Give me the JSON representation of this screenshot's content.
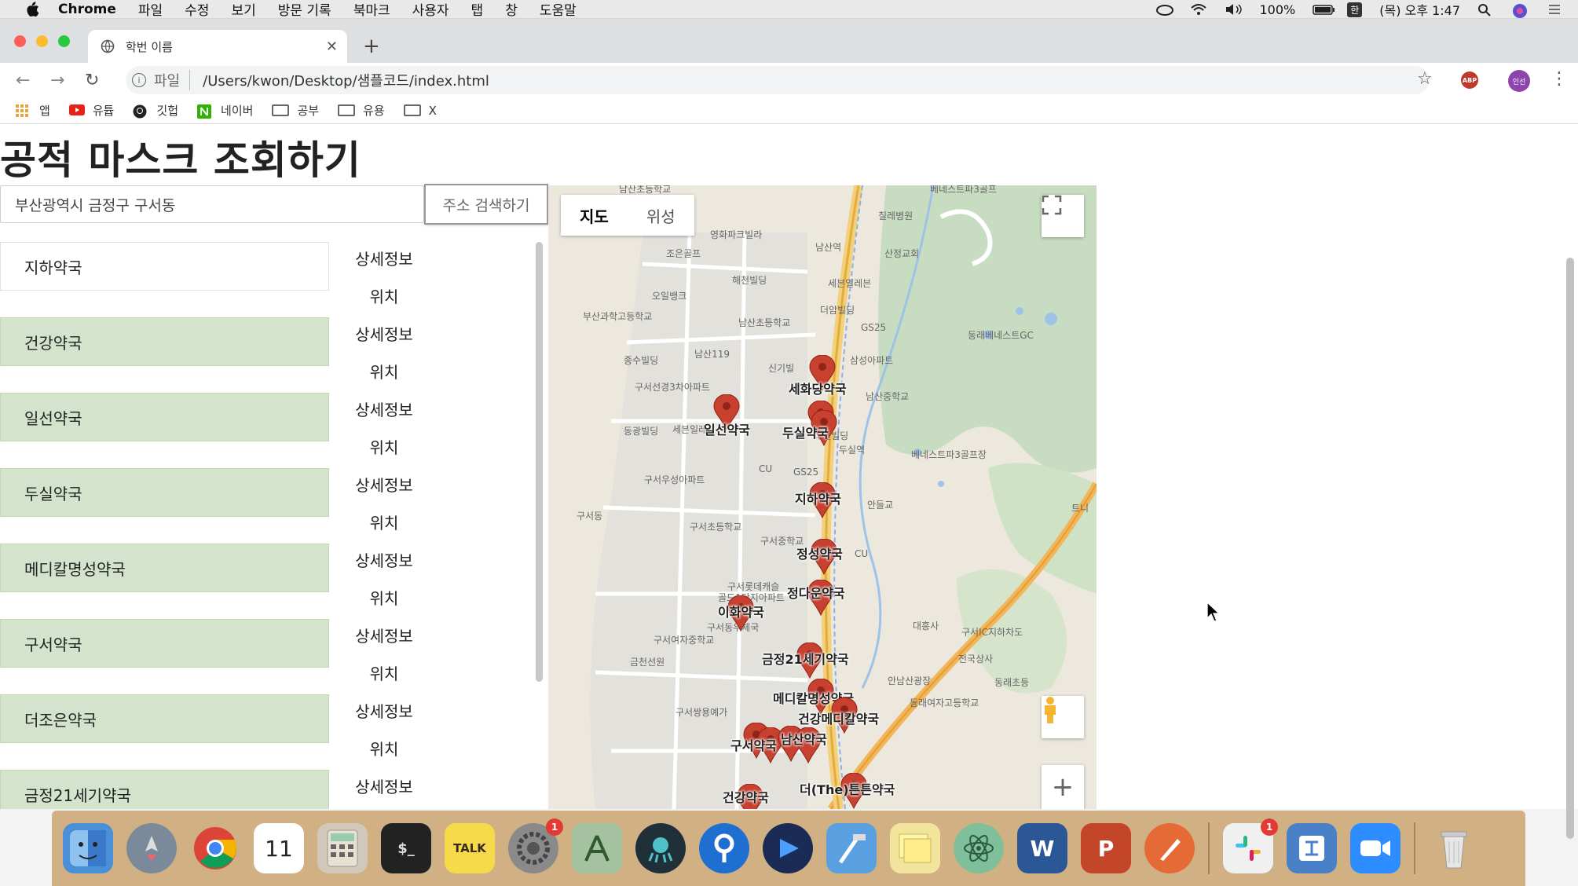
{
  "menubar": {
    "app_name": "Chrome",
    "items": [
      "파일",
      "수정",
      "보기",
      "방문 기록",
      "북마크",
      "사용자",
      "탭",
      "창",
      "도움말"
    ],
    "battery": "100%",
    "ime": "한",
    "clock": "(목) 오후 1:47"
  },
  "browser": {
    "tab_title": "학번 이름",
    "url_scheme": "파일",
    "url": "/Users/kwon/Desktop/샘플코드/index.html",
    "profile_label": "인선",
    "abp_label": "ABP"
  },
  "bookmarks": [
    {
      "label": "앱",
      "icon": "apps-grid-icon"
    },
    {
      "label": "유튭",
      "icon": "youtube-icon"
    },
    {
      "label": "깃헙",
      "icon": "github-icon"
    },
    {
      "label": "네이버",
      "icon": "naver-icon"
    },
    {
      "label": "공부",
      "icon": "folder-icon"
    },
    {
      "label": "유용",
      "icon": "folder-icon"
    },
    {
      "label": "X",
      "icon": "folder-icon"
    }
  ],
  "page": {
    "title": "공적 마스크 조회하기",
    "search_value": "부산광역시 금정구 구서동",
    "search_button": "주소 검색하기",
    "detail_label": "상세정보",
    "location_label": "위치",
    "pharmacies": [
      {
        "name": "지하약국",
        "highlight": false
      },
      {
        "name": "건강약국",
        "highlight": true
      },
      {
        "name": "일선약국",
        "highlight": true
      },
      {
        "name": "두실약국",
        "highlight": true
      },
      {
        "name": "메디칼명성약국",
        "highlight": true
      },
      {
        "name": "구서약국",
        "highlight": true
      },
      {
        "name": "더조은약국",
        "highlight": true
      },
      {
        "name": "금정21세기약국",
        "highlight": true
      }
    ]
  },
  "map": {
    "type_map": "지도",
    "type_satellite": "위성",
    "places": [
      "남산초등학교",
      "영화파크빌라",
      "남산역",
      "산정교회",
      "조은골프",
      "해천빌딩",
      "세븐일레븐",
      "오일뱅크",
      "더암빌딩",
      "부산과학고등학교",
      "남산초등학교",
      "GS25",
      "동래베네스트GC",
      "종수빌딩",
      "남산119",
      "신기빌",
      "삼성아파트",
      "구서선경3차아파트",
      "남산중학교",
      "동광빌딩",
      "세븐일레븐",
      "대원빌딩",
      "두실역",
      "베네스트파3골프장",
      "CU",
      "GS25",
      "구서우성아파트",
      "구서동",
      "안들교",
      "구서초등학교",
      "구서중학교",
      "CU",
      "구서롯데캐슬",
      "골드1단지아파트",
      "구서동우체국",
      "구서여자중학교",
      "금천선원",
      "대흥사",
      "구서IC지하차도",
      "전국상사",
      "안남산광장",
      "동래초등",
      "동래여자고등학교",
      "구서쌍용예가",
      "베네스트파3골프",
      "칠레병원",
      "트니"
    ],
    "markers": [
      {
        "label": "세화당약국"
      },
      {
        "label": "일선약국"
      },
      {
        "label": "두실약국"
      },
      {
        "label": "지하약국"
      },
      {
        "label": "정성약국"
      },
      {
        "label": "정다운약국"
      },
      {
        "label": "이화약국"
      },
      {
        "label": "금정21세기약국"
      },
      {
        "label": "메디칼명성약국"
      },
      {
        "label": "건강메디칼약국"
      },
      {
        "label": "구서약국"
      },
      {
        "label": "남산약국"
      },
      {
        "label": "더(The)튼튼약국"
      },
      {
        "label": "건강약국"
      }
    ],
    "colors": {
      "marker": "#c8402f",
      "road_major": "#f2b65a",
      "park": "#c7dcc0",
      "water": "#9ec3e8"
    }
  },
  "dock": {
    "apps": [
      {
        "name": "finder-icon",
        "color": "#4a90d9",
        "label": ""
      },
      {
        "name": "launchpad-icon",
        "color": "#7a8a9a",
        "label": ""
      },
      {
        "name": "chrome-icon",
        "color": "#e0e0e0",
        "label": ""
      },
      {
        "name": "calendar-icon",
        "color": "#ffffff",
        "label": "11"
      },
      {
        "name": "calculator-icon",
        "color": "#d0c8b8",
        "label": ""
      },
      {
        "name": "terminal-icon",
        "color": "#222222",
        "label": "$_"
      },
      {
        "name": "kakaotalk-icon",
        "color": "#f7d94c",
        "label": "TALK"
      },
      {
        "name": "system-preferences-icon",
        "color": "#8a8a8a",
        "label": "",
        "badge": "1"
      },
      {
        "name": "android-studio-icon",
        "color": "#a4c2a0",
        "label": ""
      },
      {
        "name": "gitkraken-icon",
        "color": "#203038",
        "label": ""
      },
      {
        "name": "sourcetree-icon",
        "color": "#1f6fd0",
        "label": ""
      },
      {
        "name": "app-blue-icon",
        "color": "#1a2c55",
        "label": ""
      },
      {
        "name": "xcode-icon",
        "color": "#5aa0e0",
        "label": ""
      },
      {
        "name": "stickies-icon",
        "color": "#f2e49a",
        "label": ""
      },
      {
        "name": "atom-icon",
        "color": "#7fbf9a",
        "label": ""
      },
      {
        "name": "word-icon",
        "color": "#2b5797",
        "label": "W"
      },
      {
        "name": "powerpoint-icon",
        "color": "#c4462a",
        "label": "P"
      },
      {
        "name": "sketch-icon",
        "color": "#e46a36",
        "label": ""
      },
      {
        "name": "slack-icon",
        "color": "#f0f0f0",
        "label": "",
        "badge": "1"
      },
      {
        "name": "hangul-icon",
        "color": "#4a80c8",
        "label": ""
      },
      {
        "name": "zoom-icon",
        "color": "#2d8cff",
        "label": ""
      },
      {
        "name": "trash-icon",
        "color": "#d8d8d8",
        "label": ""
      }
    ]
  }
}
